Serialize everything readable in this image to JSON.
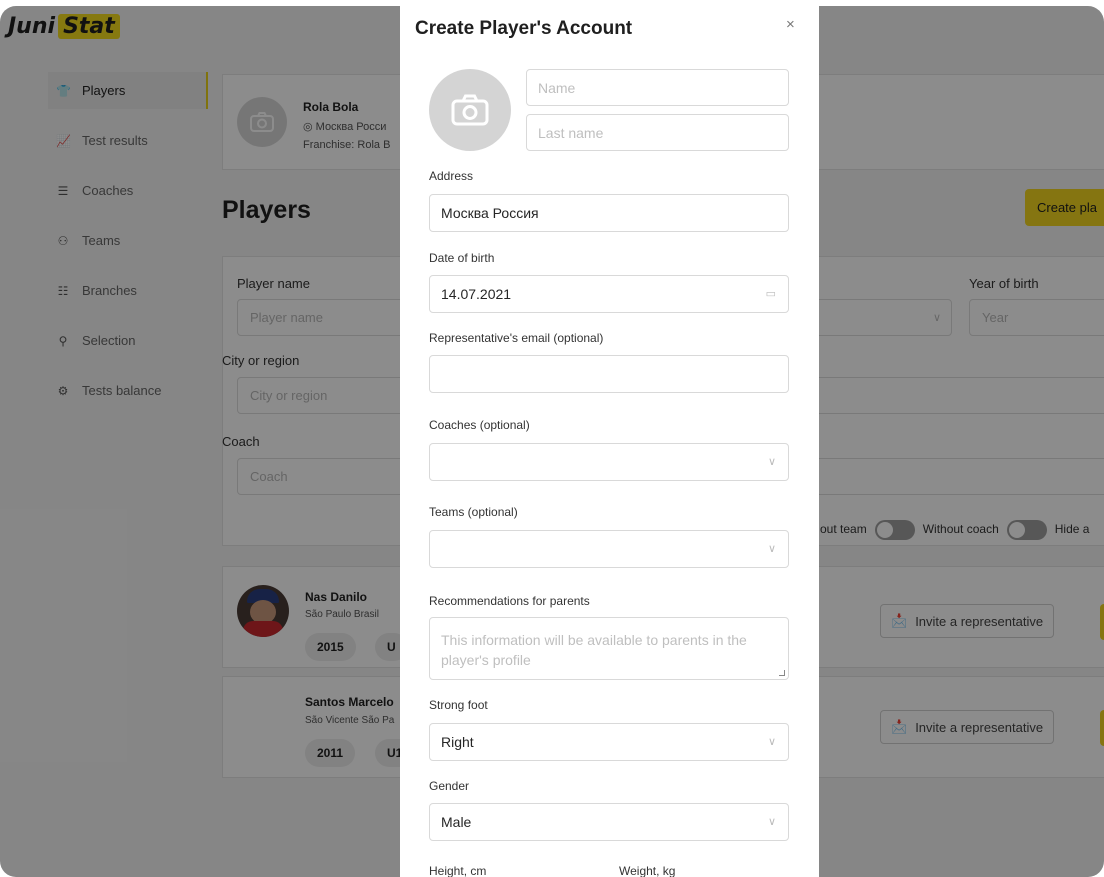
{
  "app": {
    "logo_part1": "Juni",
    "logo_part2": "Stat"
  },
  "sidebar": {
    "items": [
      {
        "label": "Players",
        "icon": "shirt-icon",
        "glyph": "👕"
      },
      {
        "label": "Test results",
        "icon": "chart-icon",
        "glyph": "📈"
      },
      {
        "label": "Coaches",
        "icon": "clipboard-icon",
        "glyph": "☰"
      },
      {
        "label": "Teams",
        "icon": "team-icon",
        "glyph": "⚇"
      },
      {
        "label": "Branches",
        "icon": "branches-icon",
        "glyph": "☷"
      },
      {
        "label": "Selection",
        "icon": "search-icon",
        "glyph": "⚲"
      },
      {
        "label": "Tests balance",
        "icon": "gear-icon",
        "glyph": "⚙"
      }
    ]
  },
  "profile": {
    "name": "Rola Bola",
    "location": "Москва Росси",
    "franchise": "Franchise: Rola B"
  },
  "page": {
    "title": "Players",
    "create_button": "Create pla"
  },
  "filters": {
    "player_name_label": "Player name",
    "player_name_placeholder": "Player name",
    "year_label": "Year of birth",
    "year_placeholder": "Year",
    "city_label": "City or region",
    "city_placeholder": "City or region",
    "coach_label": "Coach",
    "coach_placeholder": "Coach",
    "toggle_without_team": "out team",
    "toggle_without_coach": "Without coach",
    "toggle_hide": "Hide a"
  },
  "players": [
    {
      "name": "Nas Danilo",
      "location": "São Paulo Brasil",
      "year": "2015",
      "age": "U",
      "invite": "Invite a representative"
    },
    {
      "name": "Santos Marcelo",
      "location": "São Vicente São Pa",
      "year": "2011",
      "age": "U1",
      "invite": "Invite a representative"
    }
  ],
  "modal": {
    "title": "Create Player's Account",
    "close": "×",
    "name_placeholder": "Name",
    "last_name_placeholder": "Last name",
    "address_label": "Address",
    "address_value": "Москва  Россия",
    "dob_label": "Date of birth",
    "dob_value": "14.07.2021",
    "email_label": "Representative's email (optional)",
    "coaches_label": "Coaches (optional)",
    "teams_label": "Teams (optional)",
    "recommendations_label": "Recommendations for parents",
    "recommendations_placeholder": "This information will be available to parents in the player's profile",
    "strong_foot_label": "Strong foot",
    "strong_foot_value": "Right",
    "gender_label": "Gender",
    "gender_value": "Male",
    "height_label": "Height, cm",
    "weight_label": "Weight, kg"
  },
  "colors": {
    "accent": "#f2d620",
    "overlay": "rgba(0,0,0,0.45)"
  }
}
